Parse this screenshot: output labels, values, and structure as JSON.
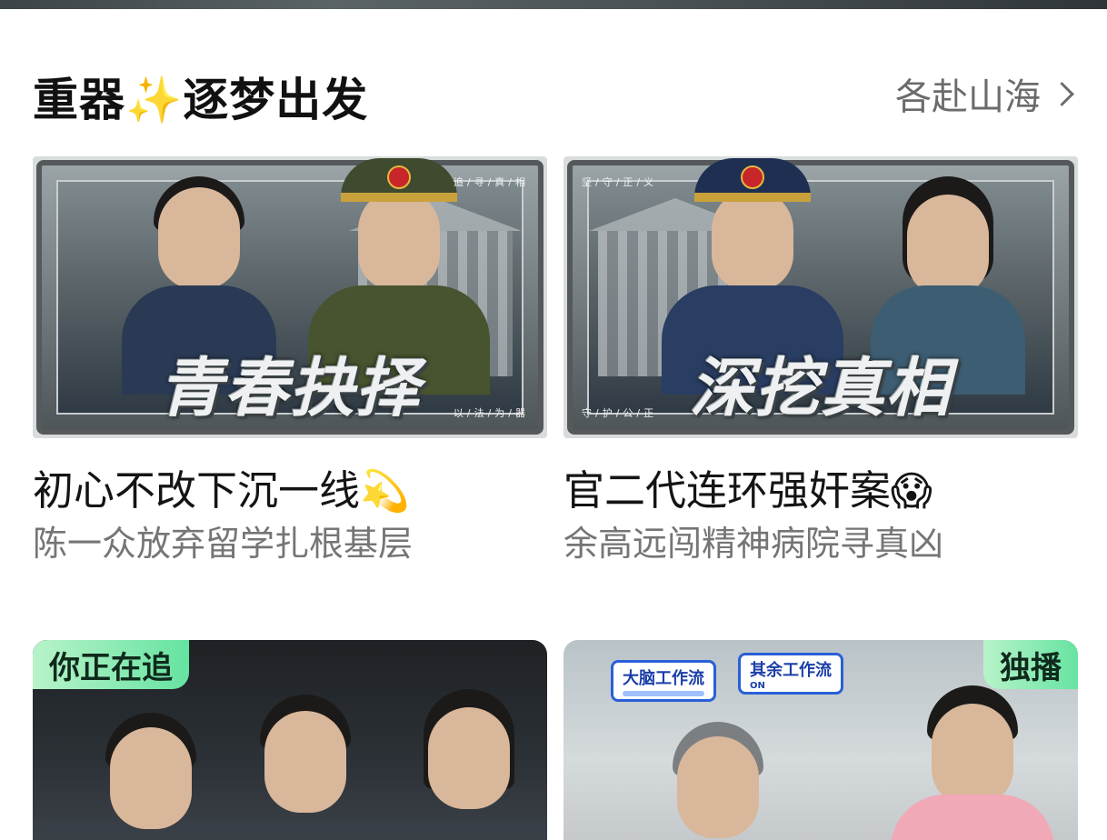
{
  "section": {
    "title_part1": "重器",
    "title_sparkle": "✨",
    "title_part2": "逐梦出发",
    "more_label": "各赴山海"
  },
  "cards": [
    {
      "poster_title": "青春抉择",
      "poster_tag_top": "追/寻/真/相",
      "poster_tag_bottom": "以/法/为/器",
      "title": "初心不改下沉一线",
      "title_emoji": "💫",
      "subtitle": "陈一众放弃留学扎根基层"
    },
    {
      "poster_title": "深挖真相",
      "poster_tag_top": "坚/守/正/义",
      "poster_tag_bottom": "守/护/公/正",
      "title": "官二代连环强奸案",
      "title_emoji": "😱",
      "subtitle": "余高远闯精神病院寻真凶"
    }
  ],
  "thumbs": [
    {
      "badge": "你正在追"
    },
    {
      "badge": "独播",
      "label_brain": "大脑工作流",
      "label_other": "其余工作流",
      "label_other_state": "ON"
    }
  ],
  "icons": {
    "more": "chevron-right-icon"
  }
}
